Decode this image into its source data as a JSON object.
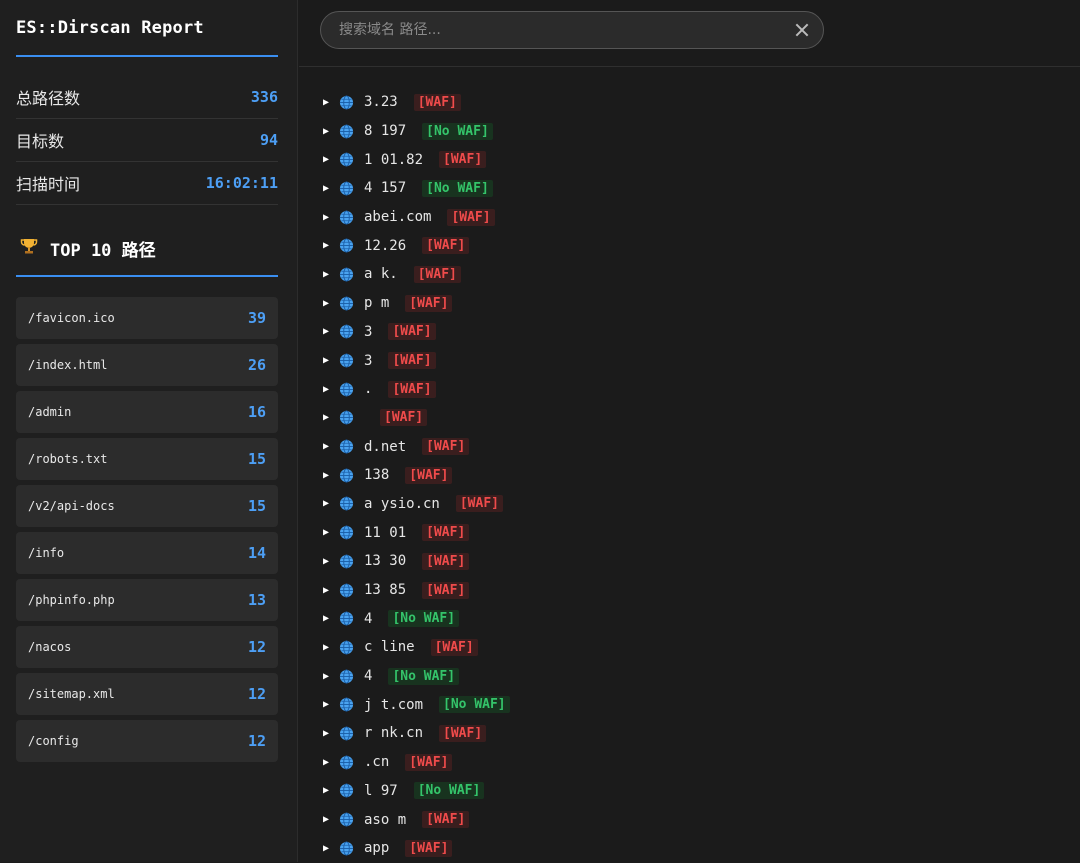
{
  "sidebar": {
    "title": "ES::Dirscan Report",
    "stats": [
      {
        "label": "总路径数",
        "value": "336"
      },
      {
        "label": "目标数",
        "value": "94"
      },
      {
        "label": "扫描时间",
        "value": "16:02:11"
      }
    ],
    "top_heading": "TOP 10 路径",
    "top_icon": "trophy-icon",
    "top_paths": [
      {
        "path": "/favicon.ico",
        "count": "39"
      },
      {
        "path": "/index.html",
        "count": "26"
      },
      {
        "path": "/admin",
        "count": "16"
      },
      {
        "path": "/robots.txt",
        "count": "15"
      },
      {
        "path": "/v2/api-docs",
        "count": "15"
      },
      {
        "path": "/info",
        "count": "14"
      },
      {
        "path": "/phpinfo.php",
        "count": "13"
      },
      {
        "path": "/nacos",
        "count": "12"
      },
      {
        "path": "/sitemap.xml",
        "count": "12"
      },
      {
        "path": "/config",
        "count": "12"
      }
    ]
  },
  "search": {
    "placeholder": "搜索域名 路径...",
    "close_icon": "close-icon"
  },
  "colors": {
    "accent": "#4d9ff5",
    "waf": "#ef4b4b",
    "no_waf": "#34c46a"
  },
  "targets": [
    {
      "host": "3.23",
      "badge": "[WAF]",
      "waf": true
    },
    {
      "host": "8 197",
      "badge": "[No WAF]",
      "waf": false
    },
    {
      "host": "1 01.82",
      "badge": "[WAF]",
      "waf": true
    },
    {
      "host": "4 157",
      "badge": "[No WAF]",
      "waf": false
    },
    {
      "host": "abei.com",
      "badge": "[WAF]",
      "waf": true
    },
    {
      "host": "12.26",
      "badge": "[WAF]",
      "waf": true
    },
    {
      "host": "a k.",
      "badge": "[WAF]",
      "waf": true
    },
    {
      "host": "p m",
      "badge": "[WAF]",
      "waf": true
    },
    {
      "host": "3",
      "badge": "[WAF]",
      "waf": true
    },
    {
      "host": "3",
      "badge": "[WAF]",
      "waf": true
    },
    {
      "host": ".",
      "badge": "[WAF]",
      "waf": true
    },
    {
      "host": "",
      "badge": "[WAF]",
      "waf": true
    },
    {
      "host": "d.net",
      "badge": "[WAF]",
      "waf": true
    },
    {
      "host": "138",
      "badge": "[WAF]",
      "waf": true
    },
    {
      "host": "a ysio.cn",
      "badge": "[WAF]",
      "waf": true
    },
    {
      "host": "11 01",
      "badge": "[WAF]",
      "waf": true
    },
    {
      "host": "13 30",
      "badge": "[WAF]",
      "waf": true
    },
    {
      "host": "13 85",
      "badge": "[WAF]",
      "waf": true
    },
    {
      "host": "4",
      "badge": "[No WAF]",
      "waf": false
    },
    {
      "host": "c line",
      "badge": "[WAF]",
      "waf": true
    },
    {
      "host": "4",
      "badge": "[No WAF]",
      "waf": false
    },
    {
      "host": "j t.com",
      "badge": "[No WAF]",
      "waf": false
    },
    {
      "host": "r nk.cn",
      "badge": "[WAF]",
      "waf": true
    },
    {
      "host": ".cn",
      "badge": "[WAF]",
      "waf": true
    },
    {
      "host": "l 97",
      "badge": "[No WAF]",
      "waf": false
    },
    {
      "host": "aso m",
      "badge": "[WAF]",
      "waf": true
    },
    {
      "host": "app",
      "badge": "[WAF]",
      "waf": true
    }
  ]
}
